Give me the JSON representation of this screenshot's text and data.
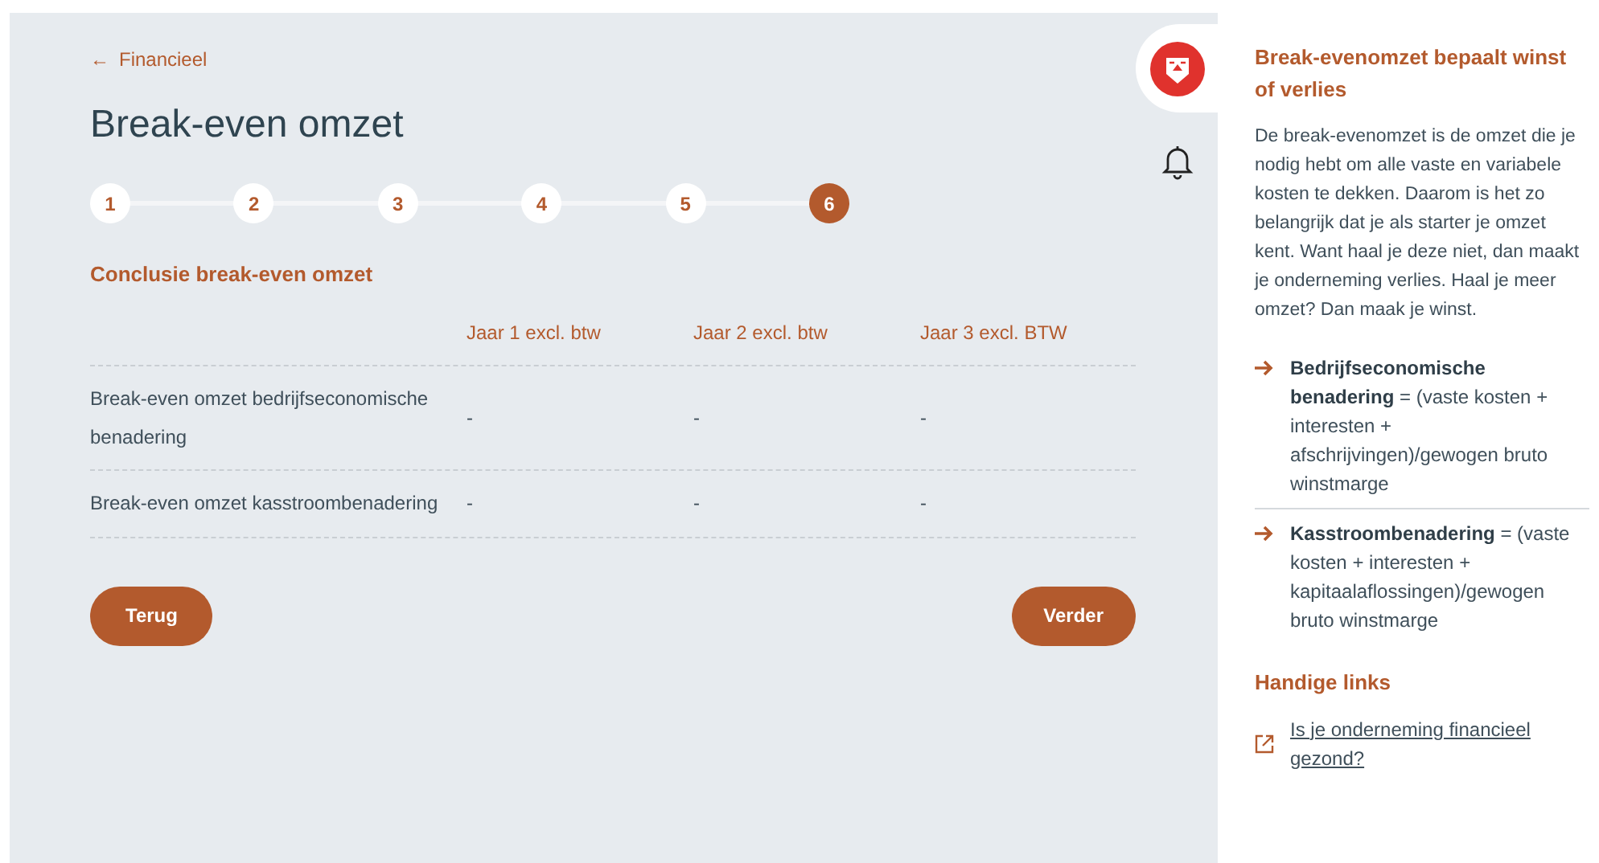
{
  "back_link": {
    "icon": "←",
    "label": "Financieel"
  },
  "title": "Break-even omzet",
  "steps": [
    {
      "label": "1",
      "selected": false
    },
    {
      "label": "2",
      "selected": false
    },
    {
      "label": "3",
      "selected": false
    },
    {
      "label": "4",
      "selected": false
    },
    {
      "label": "5",
      "selected": false
    },
    {
      "label": "6",
      "selected": true
    }
  ],
  "section_title": "Conclusie break-even omzet",
  "table": {
    "columns": [
      "Jaar 1 excl. btw",
      "Jaar 2 excl. btw",
      "Jaar 3 excl. BTW"
    ],
    "rows": [
      {
        "label": "Break-even omzet bedrijfseconomische benadering",
        "values": [
          "-",
          "-",
          "-"
        ]
      },
      {
        "label": "Break-even omzet kasstroombenadering",
        "values": [
          "-",
          "-",
          "-"
        ]
      }
    ]
  },
  "buttons": {
    "back": "Terug",
    "next": "Verder"
  },
  "sidebar": {
    "title": "Break-evenomzet bepaalt winst of verlies",
    "intro": "De break-evenomzet is de omzet die je nodig hebt om alle vaste en variabele kosten te dekken. Daarom is het zo belangrijk dat je als starter je omzet kent. Want haal je deze niet, dan maakt je onderneming verlies. Haal je meer omzet? Dan maak je winst.",
    "formulas": [
      "**Bedrijfseconomische benadering** = (vaste kosten + interesten + afschrijvingen)/gewogen bruto winstmarge",
      "**Kasstroombenadering** = (vaste kosten + interesten + kapitaalaflossingen)/gewogen bruto winstmarge"
    ],
    "links_title": "Handige links",
    "links": [
      "Is je onderneming financieel gezond?"
    ]
  }
}
